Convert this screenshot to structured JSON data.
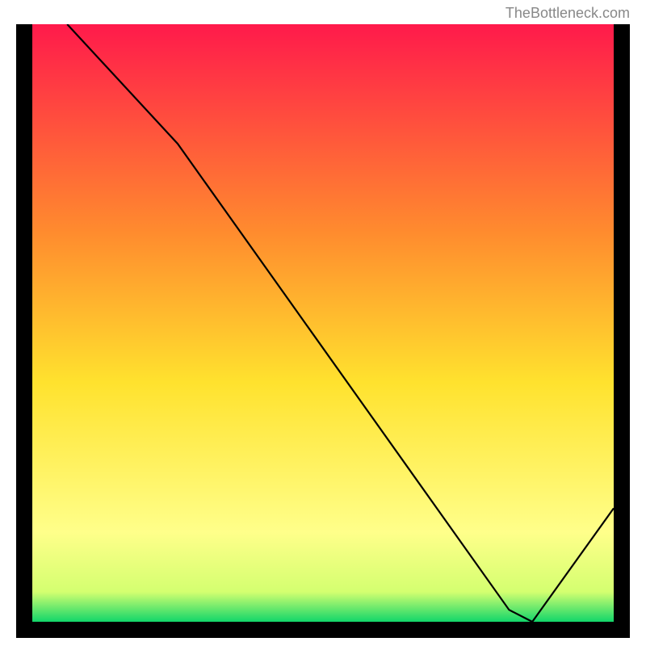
{
  "watermark": "TheBottleneck.com",
  "chart_data": {
    "type": "line",
    "title": "",
    "xlabel": "",
    "ylabel": "",
    "xlim": [
      0,
      100
    ],
    "ylim": [
      0,
      100
    ],
    "x": [
      6,
      25,
      82,
      86,
      100
    ],
    "values": [
      100,
      80,
      2,
      0,
      19
    ],
    "optimal_x": 86,
    "marker_label": "",
    "gradient_stops": [
      {
        "offset": 0,
        "color": "#ff1a4b"
      },
      {
        "offset": 35,
        "color": "#ff8c2e"
      },
      {
        "offset": 60,
        "color": "#ffe22e"
      },
      {
        "offset": 85,
        "color": "#ffff8a"
      },
      {
        "offset": 95,
        "color": "#d4ff70"
      },
      {
        "offset": 100,
        "color": "#12d66a"
      }
    ],
    "line_color": "#000000",
    "line_width": 2.2
  }
}
